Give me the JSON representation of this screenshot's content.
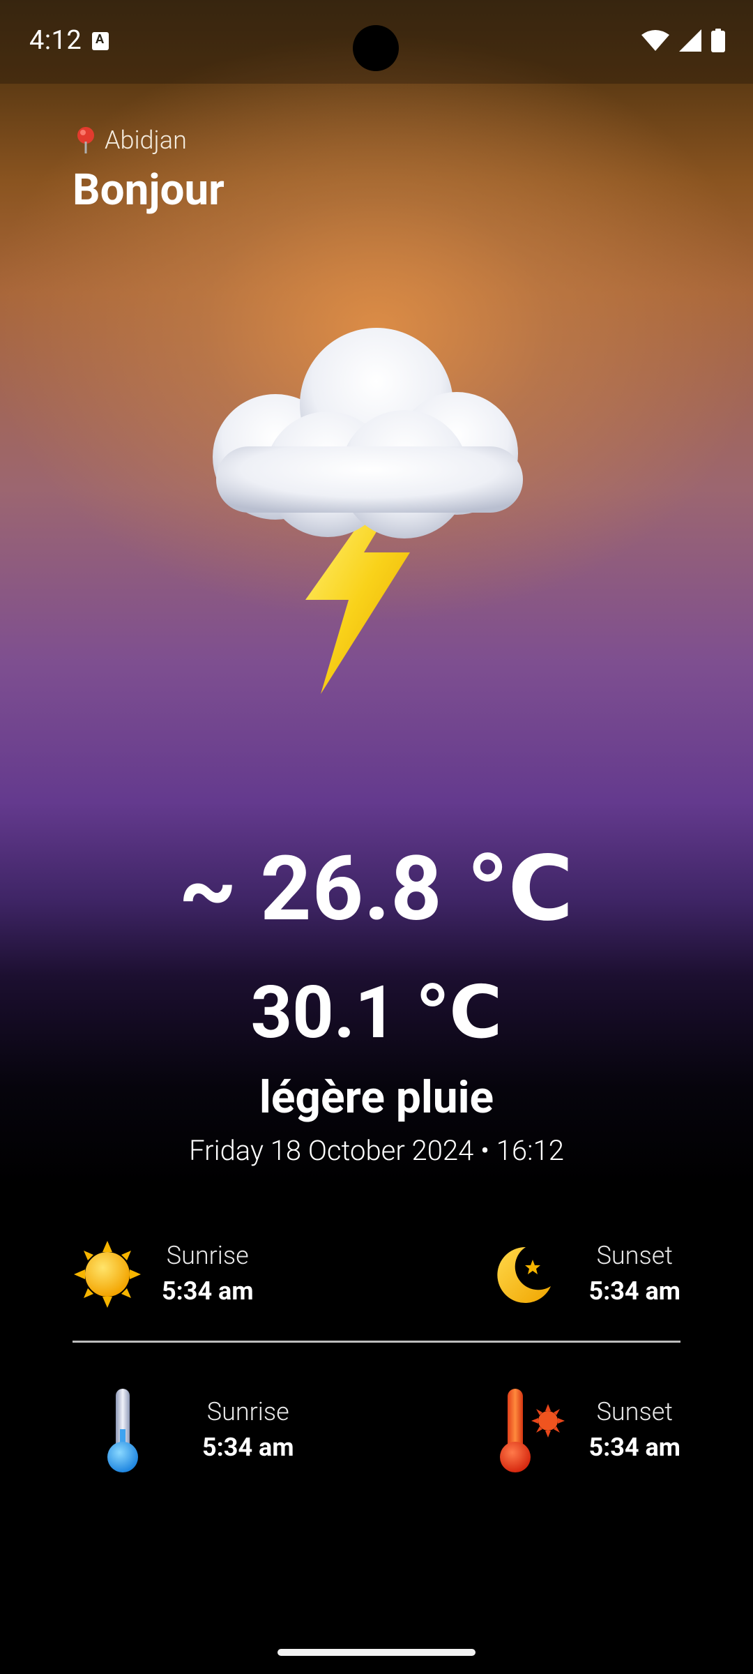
{
  "status_bar": {
    "time": "4:12",
    "icons": [
      "notification-icon",
      "wifi-icon",
      "cell-signal-icon",
      "battery-icon"
    ]
  },
  "header": {
    "location": "Abidjan",
    "location_icon": "map-pin-icon",
    "greeting": "Bonjour"
  },
  "weather": {
    "icon": "thunderstorm-cloud-icon",
    "temperature": "~ 26.8 ℃",
    "feels_like": "30.1 ℃",
    "condition": "légère pluie",
    "datetime": "Friday 18 October 2024 • 16:12"
  },
  "details": {
    "row1": {
      "left": {
        "icon": "sun-icon",
        "label": "Sunrise",
        "value": "5:34 am"
      },
      "right": {
        "icon": "moon-icon",
        "label": "Sunset",
        "value": "5:34 am"
      }
    },
    "row2": {
      "left": {
        "icon": "cold-thermometer-icon",
        "label": "Sunrise",
        "value": "5:34 am"
      },
      "right": {
        "icon": "hot-thermometer-icon",
        "label": "Sunset",
        "value": "5:34 am"
      }
    }
  },
  "colors": {
    "sky_top": "#8a5420",
    "sky_glow": "#de8e46",
    "sky_purple": "#643a8e",
    "background": "#000000",
    "text": "#ffffff",
    "divider": "#bdbdbd"
  }
}
